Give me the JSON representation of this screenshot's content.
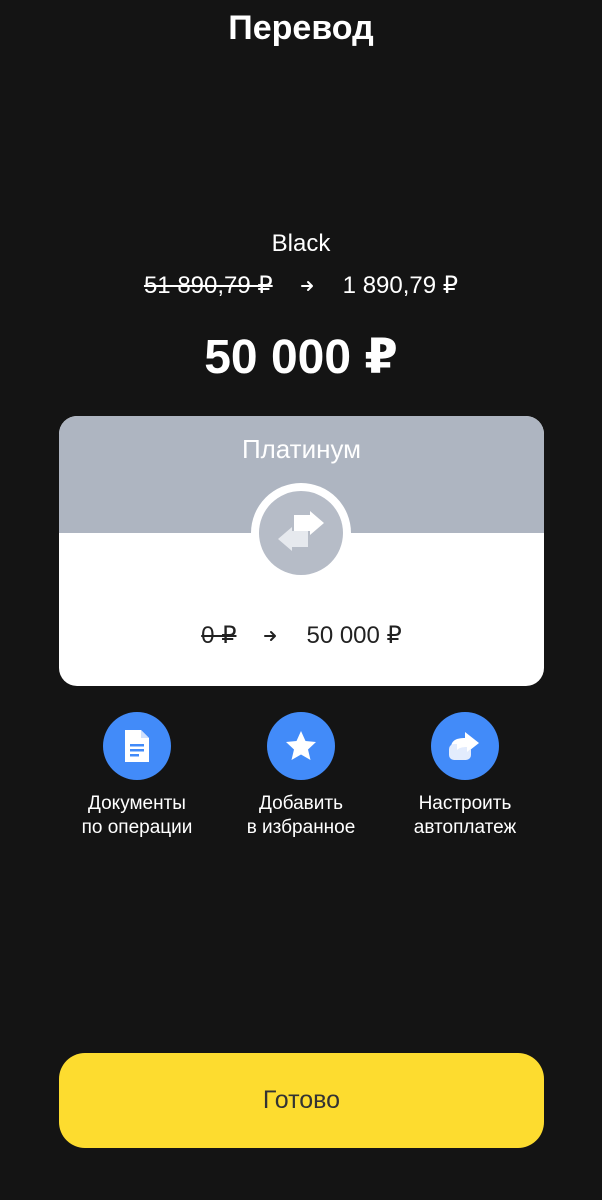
{
  "header": {
    "title": "Перевод"
  },
  "source": {
    "name": "Black",
    "balance_before": "51 890,79 ₽",
    "balance_after": "1 890,79 ₽"
  },
  "transfer": {
    "amount": "50 000 ₽"
  },
  "destination": {
    "name": "Платинум",
    "balance_before": "0 ₽",
    "balance_after": "50 000 ₽"
  },
  "actions": {
    "documents": {
      "line1": "Документы",
      "line2": "по операции",
      "icon": "document-icon"
    },
    "favorite": {
      "line1": "Добавить",
      "line2": "в избранное",
      "icon": "star-icon"
    },
    "autopay": {
      "line1": "Настроить",
      "line2": "автоплатеж",
      "icon": "share-arrow-icon"
    }
  },
  "footer": {
    "done_label": "Готово"
  },
  "colors": {
    "background": "#141414",
    "accent_blue": "#428bf9",
    "card_header": "#aeb5c1",
    "done_button": "#fddc2f"
  }
}
